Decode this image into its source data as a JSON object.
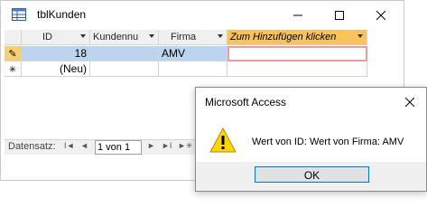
{
  "window": {
    "title": "tblKunden",
    "minimize_glyph": "—",
    "maximize_glyph": "☐",
    "close_glyph": "✕"
  },
  "grid": {
    "columns": [
      "ID",
      "Kundennu",
      "Firma",
      "Zum Hinzufügen klicken"
    ],
    "rows": [
      {
        "selector": "✎",
        "id": "18",
        "kundennummer": "",
        "firma": "AMV",
        "add": ""
      },
      {
        "selector": "✳",
        "id": "(Neu)",
        "kundennummer": "",
        "firma": "",
        "add": ""
      }
    ]
  },
  "record_nav": {
    "label": "Datensatz:",
    "first": "I◄",
    "prev": "◄",
    "current": "1 von 1",
    "next": "►",
    "last": "►I",
    "new": "►✳"
  },
  "dialog": {
    "title": "Microsoft Access",
    "message": "Wert von ID:  Wert von Firma: AMV",
    "ok_label": "OK",
    "close_glyph": "✕"
  },
  "colors": {
    "header_accent": "#f7c35a",
    "selected_row": "#bcd4ee",
    "warning": "#ffd700",
    "button_border": "#0078d7"
  },
  "icons": {
    "table": "table-icon",
    "record_selector_edit": "pencil-icon",
    "record_selector_new": "asterisk-icon",
    "warning": "warning-icon"
  }
}
